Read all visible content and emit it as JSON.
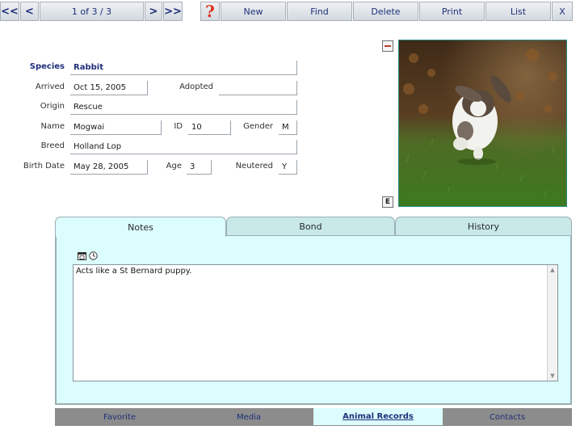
{
  "toolbar": {
    "first_label": "<<",
    "prev_label": "<",
    "record_position": "1 of 3 / 3",
    "next_label": ">",
    "last_label": ">>",
    "help_label": "?",
    "new_label": "New",
    "find_label": "Find",
    "delete_label": "Delete",
    "print_label": "Print",
    "list_label": "List",
    "close_label": "X"
  },
  "record": {
    "species": {
      "label": "Species",
      "value": "Rabbit"
    },
    "arrived": {
      "label": "Arrived",
      "value": "Oct 15, 2005"
    },
    "adopted": {
      "label": "Adopted",
      "value": ""
    },
    "origin": {
      "label": "Origin",
      "value": "Rescue"
    },
    "name": {
      "label": "Name",
      "value": "Mogwai"
    },
    "id": {
      "label": "ID",
      "value": "10"
    },
    "gender": {
      "label": "Gender",
      "value": "M"
    },
    "breed": {
      "label": "Breed",
      "value": "Holland Lop"
    },
    "birth_date": {
      "label": "Birth Date",
      "value": "May 28, 2005"
    },
    "age": {
      "label": "Age",
      "value": "3"
    },
    "neutered": {
      "label": "Neutered",
      "value": "Y"
    }
  },
  "photo": {
    "remove_icon": "minus-icon",
    "edit_label": "E"
  },
  "tabs": [
    {
      "label": "Notes",
      "active": true
    },
    {
      "label": "Bond",
      "active": false
    },
    {
      "label": "History",
      "active": false
    }
  ],
  "notes": {
    "icons": [
      "calendar-icon",
      "clock-icon"
    ],
    "text": "Acts like a St Bernard puppy."
  },
  "bottom_nav": [
    {
      "label": "Favorite",
      "active": false
    },
    {
      "label": "Media",
      "active": false
    },
    {
      "label": "Animal Records",
      "active": true
    },
    {
      "label": "Contacts",
      "active": false
    }
  ],
  "colors": {
    "link": "#1f2f7a",
    "panel": "#dcfdfd",
    "tab_inactive": "#c8e9e8",
    "help": "#e0301e",
    "bottom_bar": "#8c8c8c"
  }
}
